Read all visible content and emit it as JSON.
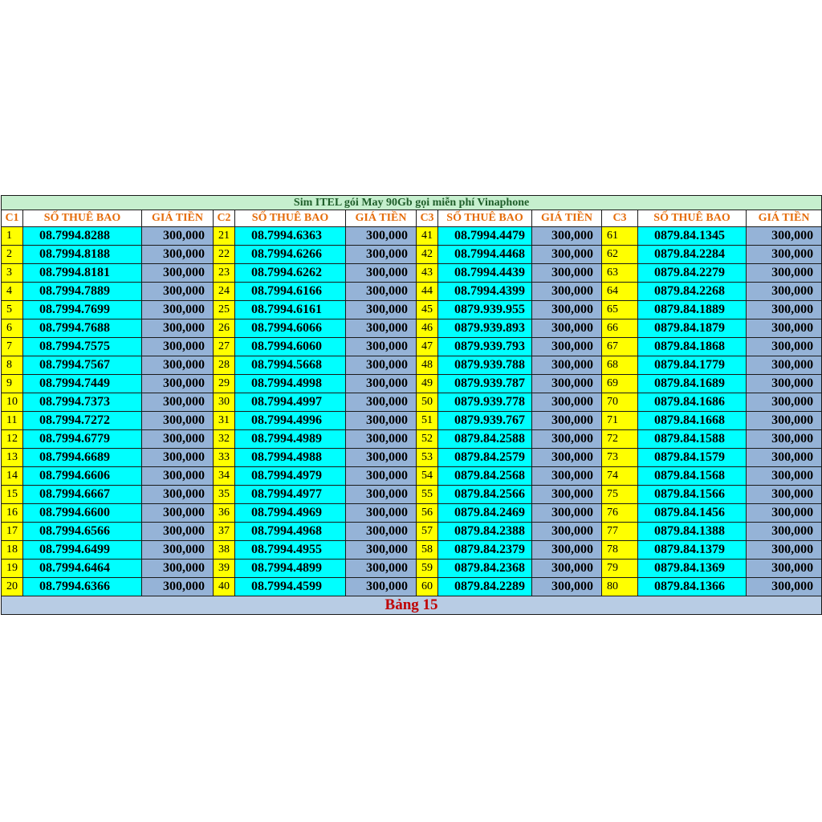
{
  "title": "Sim ITEL gói May 90Gb gọi miễn phí Vinaphone",
  "headers": [
    {
      "c": "C1",
      "num": "SỐ THUÊ BAO",
      "price": "GIÁ TIỀN"
    },
    {
      "c": "C2",
      "num": "SỐ THUÊ BAO",
      "price": "GIÁ TIỀN"
    },
    {
      "c": "C3",
      "num": "SỐ THUÊ BAO",
      "price": "GIÁ TIỀN"
    },
    {
      "c": "C3",
      "num": "SỐ THUÊ BAO",
      "price": "GIÁ TIỀN"
    }
  ],
  "rows": [
    [
      [
        "1",
        "08.7994.8288",
        "300,000"
      ],
      [
        "21",
        "08.7994.6363",
        "300,000"
      ],
      [
        "41",
        "08.7994.4479",
        "300,000"
      ],
      [
        "61",
        "0879.84.1345",
        "300,000"
      ]
    ],
    [
      [
        "2",
        "08.7994.8188",
        "300,000"
      ],
      [
        "22",
        "08.7994.6266",
        "300,000"
      ],
      [
        "42",
        "08.7994.4468",
        "300,000"
      ],
      [
        "62",
        "0879.84.2284",
        "300,000"
      ]
    ],
    [
      [
        "3",
        "08.7994.8181",
        "300,000"
      ],
      [
        "23",
        "08.7994.6262",
        "300,000"
      ],
      [
        "43",
        "08.7994.4439",
        "300,000"
      ],
      [
        "63",
        "0879.84.2279",
        "300,000"
      ]
    ],
    [
      [
        "4",
        "08.7994.7889",
        "300,000"
      ],
      [
        "24",
        "08.7994.6166",
        "300,000"
      ],
      [
        "44",
        "08.7994.4399",
        "300,000"
      ],
      [
        "64",
        "0879.84.2268",
        "300,000"
      ]
    ],
    [
      [
        "5",
        "08.7994.7699",
        "300,000"
      ],
      [
        "25",
        "08.7994.6161",
        "300,000"
      ],
      [
        "45",
        "0879.939.955",
        "300,000"
      ],
      [
        "65",
        "0879.84.1889",
        "300,000"
      ]
    ],
    [
      [
        "6",
        "08.7994.7688",
        "300,000"
      ],
      [
        "26",
        "08.7994.6066",
        "300,000"
      ],
      [
        "46",
        "0879.939.893",
        "300,000"
      ],
      [
        "66",
        "0879.84.1879",
        "300,000"
      ]
    ],
    [
      [
        "7",
        "08.7994.7575",
        "300,000"
      ],
      [
        "27",
        "08.7994.6060",
        "300,000"
      ],
      [
        "47",
        "0879.939.793",
        "300,000"
      ],
      [
        "67",
        "0879.84.1868",
        "300,000"
      ]
    ],
    [
      [
        "8",
        "08.7994.7567",
        "300,000"
      ],
      [
        "28",
        "08.7994.5668",
        "300,000"
      ],
      [
        "48",
        "0879.939.788",
        "300,000"
      ],
      [
        "68",
        "0879.84.1779",
        "300,000"
      ]
    ],
    [
      [
        "9",
        "08.7994.7449",
        "300,000"
      ],
      [
        "29",
        "08.7994.4998",
        "300,000"
      ],
      [
        "49",
        "0879.939.787",
        "300,000"
      ],
      [
        "69",
        "0879.84.1689",
        "300,000"
      ]
    ],
    [
      [
        "10",
        "08.7994.7373",
        "300,000"
      ],
      [
        "30",
        "08.7994.4997",
        "300,000"
      ],
      [
        "50",
        "0879.939.778",
        "300,000"
      ],
      [
        "70",
        "0879.84.1686",
        "300,000"
      ]
    ],
    [
      [
        "11",
        "08.7994.7272",
        "300,000"
      ],
      [
        "31",
        "08.7994.4996",
        "300,000"
      ],
      [
        "51",
        "0879.939.767",
        "300,000"
      ],
      [
        "71",
        "0879.84.1668",
        "300,000"
      ]
    ],
    [
      [
        "12",
        "08.7994.6779",
        "300,000"
      ],
      [
        "32",
        "08.7994.4989",
        "300,000"
      ],
      [
        "52",
        "0879.84.2588",
        "300,000"
      ],
      [
        "72",
        "0879.84.1588",
        "300,000"
      ]
    ],
    [
      [
        "13",
        "08.7994.6689",
        "300,000"
      ],
      [
        "33",
        "08.7994.4988",
        "300,000"
      ],
      [
        "53",
        "0879.84.2579",
        "300,000"
      ],
      [
        "73",
        "0879.84.1579",
        "300,000"
      ]
    ],
    [
      [
        "14",
        "08.7994.6606",
        "300,000"
      ],
      [
        "34",
        "08.7994.4979",
        "300,000"
      ],
      [
        "54",
        "0879.84.2568",
        "300,000"
      ],
      [
        "74",
        "0879.84.1568",
        "300,000"
      ]
    ],
    [
      [
        "15",
        "08.7994.6667",
        "300,000"
      ],
      [
        "35",
        "08.7994.4977",
        "300,000"
      ],
      [
        "55",
        "0879.84.2566",
        "300,000"
      ],
      [
        "75",
        "0879.84.1566",
        "300,000"
      ]
    ],
    [
      [
        "16",
        "08.7994.6600",
        "300,000"
      ],
      [
        "36",
        "08.7994.4969",
        "300,000"
      ],
      [
        "56",
        "0879.84.2469",
        "300,000"
      ],
      [
        "76",
        "0879.84.1456",
        "300,000"
      ]
    ],
    [
      [
        "17",
        "08.7994.6566",
        "300,000"
      ],
      [
        "37",
        "08.7994.4968",
        "300,000"
      ],
      [
        "57",
        "0879.84.2388",
        "300,000"
      ],
      [
        "77",
        "0879.84.1388",
        "300,000"
      ]
    ],
    [
      [
        "18",
        "08.7994.6499",
        "300,000"
      ],
      [
        "38",
        "08.7994.4955",
        "300,000"
      ],
      [
        "58",
        "0879.84.2379",
        "300,000"
      ],
      [
        "78",
        "0879.84.1379",
        "300,000"
      ]
    ],
    [
      [
        "19",
        "08.7994.6464",
        "300,000"
      ],
      [
        "39",
        "08.7994.4899",
        "300,000"
      ],
      [
        "59",
        "0879.84.2368",
        "300,000"
      ],
      [
        "79",
        "0879.84.1369",
        "300,000"
      ]
    ],
    [
      [
        "20",
        "08.7994.6366",
        "300,000"
      ],
      [
        "40",
        "08.7994.4599",
        "300,000"
      ],
      [
        "60",
        "0879.84.2289",
        "300,000"
      ],
      [
        "80",
        "0879.84.1366",
        "300,000"
      ]
    ]
  ],
  "footer": "Bảng 15",
  "colors": {
    "title_bg": "#c6efce",
    "header_text": "#e46c0a",
    "index_bg": "#ffff00",
    "number_bg": "#00ffff",
    "price_bg": "#95b3d7",
    "footer_bg": "#b8cce4",
    "footer_text": "#c00000"
  }
}
